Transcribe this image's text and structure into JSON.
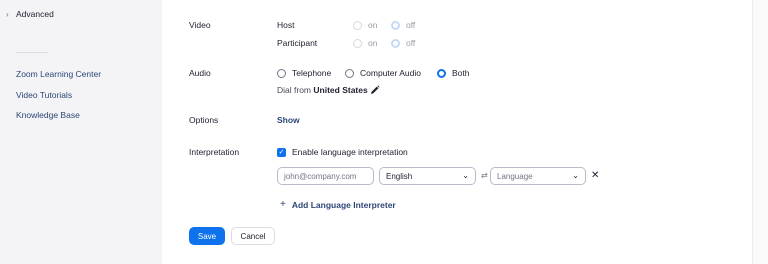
{
  "sidebar": {
    "advanced_label": "Advanced",
    "links": [
      "Zoom Learning Center",
      "Video Tutorials",
      "Knowledge Base"
    ]
  },
  "video": {
    "label": "Video",
    "host_label": "Host",
    "participant_label": "Participant",
    "on_label": "on",
    "off_label": "off"
  },
  "audio": {
    "label": "Audio",
    "options": [
      "Telephone",
      "Computer Audio",
      "Both"
    ],
    "selected": "Both",
    "dial_from_prefix": "Dial from",
    "dial_from_country": "United States"
  },
  "options": {
    "label": "Options",
    "show_link": "Show"
  },
  "interpretation": {
    "label": "Interpretation",
    "enable_label": "Enable language interpretation",
    "enabled": true,
    "email_placeholder": "john@company.com",
    "language_value": "English",
    "language_placeholder": "Language",
    "add_interpreter_label": "Add Language Interpreter"
  },
  "actions": {
    "save_label": "Save",
    "cancel_label": "Cancel"
  },
  "colors": {
    "accent": "#0e72ed",
    "link": "#2d4677"
  }
}
